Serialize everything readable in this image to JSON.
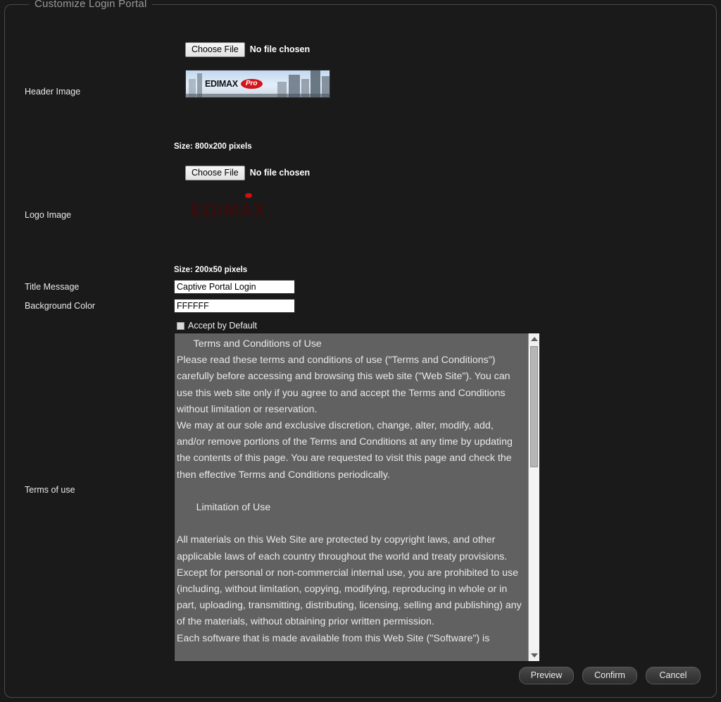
{
  "panel": {
    "legend": "Customize Login Portal"
  },
  "rows": {
    "header_image": {
      "label": "Header Image",
      "choose_label": "Choose File",
      "no_file_text": "No file chosen",
      "size_hint": "Size: 800x200 pixels",
      "preview_wordmark": "EDIMAX",
      "preview_badge": "Pro"
    },
    "logo_image": {
      "label": "Logo Image",
      "choose_label": "Choose File",
      "no_file_text": "No file chosen",
      "size_hint": "Size: 200x50 pixels",
      "preview_wordmark": "EDIMAX"
    },
    "title_message": {
      "label": "Title Message",
      "value": "Captive Portal Login"
    },
    "background_color": {
      "label": "Background Color",
      "value": "FFFFFF"
    },
    "accept_by_default": {
      "label": "Accept by Default",
      "checked": false
    },
    "terms_of_use": {
      "label": "Terms of use",
      "value": "      Terms and Conditions of Use\nPlease read these terms and conditions of use (\"Terms and Conditions\") carefully before accessing and browsing this web site (\"Web Site\"). You can use this web site only if you agree to and accept the Terms and Conditions without limitation or reservation.\nWe may at our sole and exclusive discretion, change, alter, modify, add, and/or remove portions of the Terms and Conditions at any time by updating the contents of this page. You are requested to visit this page and check the then effective Terms and Conditions periodically.\n\n       Limitation of Use\n\nAll materials on this Web Site are protected by copyright laws, and other applicable laws of each country throughout the world and treaty provisions. Except for personal or non-commercial internal use, you are prohibited to use (including, without limitation, copying, modifying, reproducing in whole or in part, uploading, transmitting, distributing, licensing, selling and publishing) any of the materials, without obtaining prior written permission.\nEach software that is made available from this Web Site (\"Software\") is"
    }
  },
  "buttons": {
    "preview": "Preview",
    "confirm": "Confirm",
    "cancel": "Cancel"
  },
  "colors": {
    "page_background": "#1a1a1a",
    "panel_border": "#4a4a4a",
    "textarea_background": "#616161",
    "input_background": "#FFFFFF",
    "accent_red": "#d4131a"
  }
}
